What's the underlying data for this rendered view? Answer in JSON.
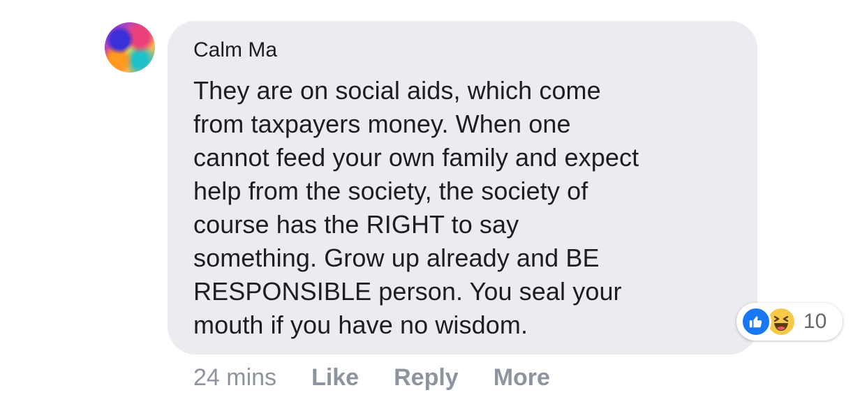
{
  "comment": {
    "author": "Calm Ma",
    "text": "They are on social aids, which come\nfrom taxpayers money. When one\ncannot feed your own family and expect\nhelp from the society, the society of\ncourse has the RIGHT to say\nsomething. Grow up already and BE\nRESPONSIBLE person. You seal your\nmouth if you have no wisdom.",
    "reactions": {
      "icons": [
        "like-icon",
        "haha-icon"
      ],
      "count": "10"
    }
  },
  "meta": {
    "time": "24 mins",
    "like_label": "Like",
    "reply_label": "Reply",
    "more_label": "More"
  },
  "colors": {
    "bubble": "#ebebf0",
    "like_blue": "#1877f2",
    "haha_yellow": "#f7c948",
    "meta_gray": "#8d949e"
  }
}
